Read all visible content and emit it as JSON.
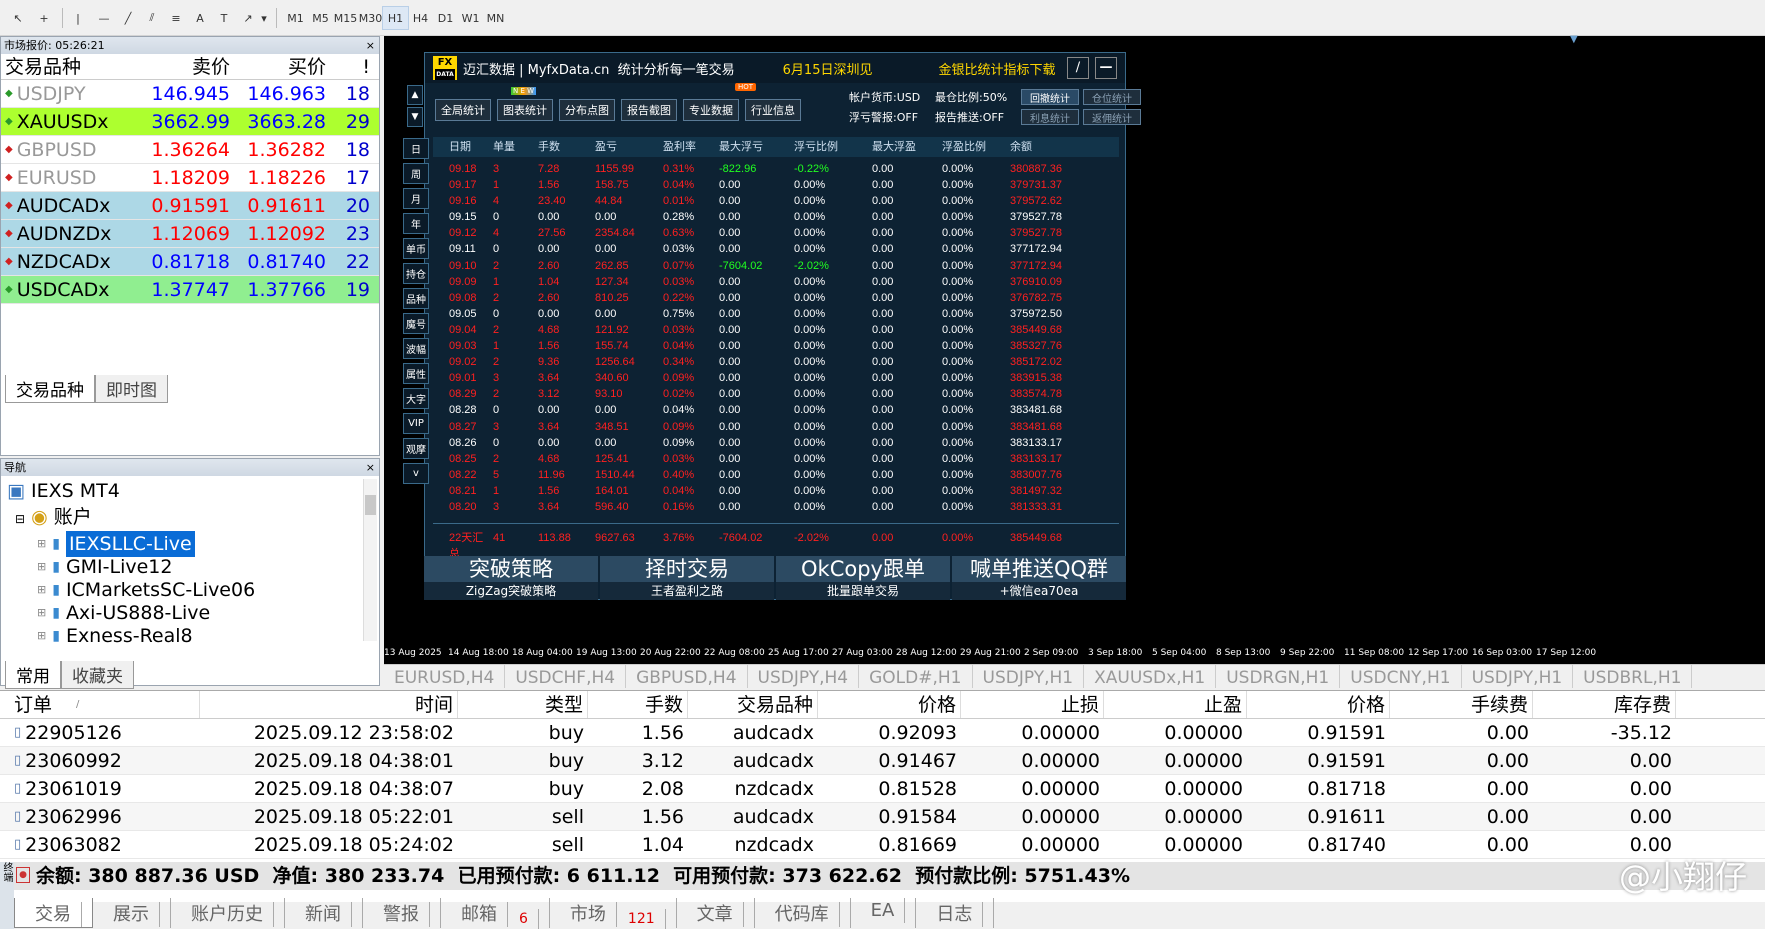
{
  "toolbar": {
    "timeframes": [
      "M1",
      "M5",
      "M15",
      "M30",
      "H1",
      "H4",
      "D1",
      "W1",
      "MN"
    ],
    "active": "H1"
  },
  "market_watch": {
    "title": "市场报价: 05:26:21",
    "close": "×",
    "headers": [
      "交易品种",
      "卖价",
      "买价",
      "!"
    ],
    "rows": [
      {
        "symbol": "USDJPY",
        "bid": "146.945",
        "ask": "146.963",
        "spread": "18",
        "bg": "#ffffff",
        "sym_color": "#999999",
        "price_color": "#0000ff",
        "icon_color": "#2a9a2a"
      },
      {
        "symbol": "XAUUSDx",
        "bid": "3662.99",
        "ask": "3663.28",
        "spread": "29",
        "bg": "#adff2f",
        "sym_color": "#000000",
        "price_color": "#0000ff",
        "icon_color": "#2a9a2a"
      },
      {
        "symbol": "GBPUSD",
        "bid": "1.36264",
        "ask": "1.36282",
        "spread": "18",
        "bg": "#ffffff",
        "sym_color": "#999999",
        "price_color": "#ff0000",
        "icon_color": "#d02020"
      },
      {
        "symbol": "EURUSD",
        "bid": "1.18209",
        "ask": "1.18226",
        "spread": "17",
        "bg": "#ffffff",
        "sym_color": "#999999",
        "price_color": "#ff0000",
        "icon_color": "#d02020"
      },
      {
        "symbol": "AUDCADx",
        "bid": "0.91591",
        "ask": "0.91611",
        "spread": "20",
        "bg": "#add8e6",
        "sym_color": "#000000",
        "price_color": "#ff0000",
        "icon_color": "#d02020"
      },
      {
        "symbol": "AUDNZDx",
        "bid": "1.12069",
        "ask": "1.12092",
        "spread": "23",
        "bg": "#add8e6",
        "sym_color": "#000000",
        "price_color": "#ff0000",
        "icon_color": "#d02020"
      },
      {
        "symbol": "NZDCADx",
        "bid": "0.81718",
        "ask": "0.81740",
        "spread": "22",
        "bg": "#add8e6",
        "sym_color": "#000000",
        "price_color": "#0000ff",
        "icon_color": "#d02020"
      },
      {
        "symbol": "USDCADx",
        "bid": "1.37747",
        "ask": "1.37766",
        "spread": "19",
        "bg": "#90ee90",
        "sym_color": "#000000",
        "price_color": "#0000ff",
        "icon_color": "#2a9a2a"
      }
    ],
    "tabs": [
      "交易品种",
      "即时图"
    ]
  },
  "navigator": {
    "title": "导航",
    "close": "×",
    "root": "IEXS MT4",
    "accounts_label": "账户",
    "accounts": [
      "IEXSLLC-Live",
      "GMI-Live12",
      "ICMarketsSC-Live06",
      "Axi-US888-Live",
      "Exness-Real8"
    ],
    "selected": "IEXSLLC-Live",
    "tabs": [
      "常用",
      "收藏夹"
    ]
  },
  "panel": {
    "logo_top": "FX",
    "logo_bottom": "DATA",
    "header_text": "迈汇数据 | MyfxData.cn  统计分析每一笔交易",
    "date_text": "6月15日深圳见",
    "right_text": "金银比统计指标下载",
    "buttons": [
      "全局统计",
      "图表统计",
      "分布点图",
      "报告截图",
      "专业数据",
      "行业信息"
    ],
    "badges": {
      "new": "N E W",
      "hot": "HOT"
    },
    "stats": [
      "帐户货币:USD",
      "最仓比例:50%",
      "浮亏警报:OFF",
      "报告推送:OFF"
    ],
    "stat_buttons": [
      "回撤统计",
      "仓位统计",
      "利息统计",
      "返佣统计"
    ],
    "side": [
      "日",
      "周",
      "月",
      "年",
      "单币",
      "持仓",
      "品种",
      "魔号",
      "波幅",
      "属性",
      "大字",
      "VIP",
      "观摩",
      "v"
    ],
    "columns": [
      "日期",
      "单量",
      "手数",
      "盈亏",
      "盈利率",
      "最大浮亏",
      "浮亏比例",
      "最大浮盈",
      "浮盈比例",
      "余额"
    ],
    "rows": [
      [
        "09.18",
        "3",
        "7.28",
        "1155.99",
        "0.31%",
        "-822.96",
        "-0.22%",
        "0.00",
        "0.00%",
        "380887.36",
        "r"
      ],
      [
        "09.17",
        "1",
        "1.56",
        "158.75",
        "0.04%",
        "0.00",
        "0.00%",
        "0.00",
        "0.00%",
        "379731.37",
        "r"
      ],
      [
        "09.16",
        "4",
        "23.40",
        "44.84",
        "0.01%",
        "0.00",
        "0.00%",
        "0.00",
        "0.00%",
        "379572.62",
        "r"
      ],
      [
        "09.15",
        "0",
        "0.00",
        "0.00",
        "0.28%",
        "0.00",
        "0.00%",
        "0.00",
        "0.00%",
        "379527.78",
        "w"
      ],
      [
        "09.12",
        "4",
        "27.56",
        "2354.84",
        "0.63%",
        "0.00",
        "0.00%",
        "0.00",
        "0.00%",
        "379527.78",
        "r"
      ],
      [
        "09.11",
        "0",
        "0.00",
        "0.00",
        "0.03%",
        "0.00",
        "0.00%",
        "0.00",
        "0.00%",
        "377172.94",
        "w"
      ],
      [
        "09.10",
        "2",
        "2.60",
        "262.85",
        "0.07%",
        "-7604.02",
        "-2.02%",
        "0.00",
        "0.00%",
        "377172.94",
        "r"
      ],
      [
        "09.09",
        "1",
        "1.04",
        "127.34",
        "0.03%",
        "0.00",
        "0.00%",
        "0.00",
        "0.00%",
        "376910.09",
        "r"
      ],
      [
        "09.08",
        "2",
        "2.60",
        "810.25",
        "0.22%",
        "0.00",
        "0.00%",
        "0.00",
        "0.00%",
        "376782.75",
        "r"
      ],
      [
        "09.05",
        "0",
        "0.00",
        "0.00",
        "0.75%",
        "0.00",
        "0.00%",
        "0.00",
        "0.00%",
        "375972.50",
        "w"
      ],
      [
        "09.04",
        "2",
        "4.68",
        "121.92",
        "0.03%",
        "0.00",
        "0.00%",
        "0.00",
        "0.00%",
        "385449.68",
        "r"
      ],
      [
        "09.03",
        "1",
        "1.56",
        "155.74",
        "0.04%",
        "0.00",
        "0.00%",
        "0.00",
        "0.00%",
        "385327.76",
        "r"
      ],
      [
        "09.02",
        "2",
        "9.36",
        "1256.64",
        "0.34%",
        "0.00",
        "0.00%",
        "0.00",
        "0.00%",
        "385172.02",
        "r"
      ],
      [
        "09.01",
        "3",
        "3.64",
        "340.60",
        "0.09%",
        "0.00",
        "0.00%",
        "0.00",
        "0.00%",
        "383915.38",
        "r"
      ],
      [
        "08.29",
        "2",
        "3.12",
        "93.10",
        "0.02%",
        "0.00",
        "0.00%",
        "0.00",
        "0.00%",
        "383574.78",
        "r"
      ],
      [
        "08.28",
        "0",
        "0.00",
        "0.00",
        "0.04%",
        "0.00",
        "0.00%",
        "0.00",
        "0.00%",
        "383481.68",
        "w"
      ],
      [
        "08.27",
        "3",
        "3.64",
        "348.51",
        "0.09%",
        "0.00",
        "0.00%",
        "0.00",
        "0.00%",
        "383481.68",
        "r"
      ],
      [
        "08.26",
        "0",
        "0.00",
        "0.00",
        "0.09%",
        "0.00",
        "0.00%",
        "0.00",
        "0.00%",
        "383133.17",
        "w"
      ],
      [
        "08.25",
        "2",
        "4.68",
        "125.41",
        "0.03%",
        "0.00",
        "0.00%",
        "0.00",
        "0.00%",
        "383133.17",
        "r"
      ],
      [
        "08.22",
        "5",
        "11.96",
        "1510.44",
        "0.40%",
        "0.00",
        "0.00%",
        "0.00",
        "0.00%",
        "383007.76",
        "r"
      ],
      [
        "08.21",
        "1",
        "1.56",
        "164.01",
        "0.04%",
        "0.00",
        "0.00%",
        "0.00",
        "0.00%",
        "381497.32",
        "r"
      ],
      [
        "08.20",
        "3",
        "3.64",
        "596.40",
        "0.16%",
        "0.00",
        "0.00%",
        "0.00",
        "0.00%",
        "381333.31",
        "r"
      ]
    ],
    "summary": [
      "22天汇总",
      "41",
      "113.88",
      "9627.63",
      "3.76%",
      "-7604.02",
      "-2.02%",
      "0.00",
      "0.00%",
      "385449.68"
    ],
    "promos": [
      {
        "big": "突破策略",
        "small": "ZigZag突破策略"
      },
      {
        "big": "择时交易",
        "small": "王者盈利之路"
      },
      {
        "big": "OkCopy跟单",
        "small": "批量跟单交易"
      },
      {
        "big": "喊单推送QQ群",
        "small": "+微信ea70ea"
      }
    ]
  },
  "time_axis": [
    "13 Aug 2025",
    "14 Aug 18:00",
    "18 Aug 04:00",
    "19 Aug 13:00",
    "20 Aug 22:00",
    "22 Aug 08:00",
    "25 Aug 17:00",
    "27 Aug 03:00",
    "28 Aug 12:00",
    "29 Aug 21:00",
    "2 Sep 09:00",
    "3 Sep 18:00",
    "5 Sep 04:00",
    "8 Sep 13:00",
    "9 Sep 22:00",
    "11 Sep 08:00",
    "12 Sep 17:00",
    "16 Sep 03:00",
    "17 Sep 12:00"
  ],
  "chart_tabs": [
    "EURUSD,H4",
    "USDCHF,H4",
    "GBPUSD,H4",
    "USDJPY,H4",
    "GOLD#,H1",
    "USDJPY,H1",
    "XAUUSDx,H1",
    "USDRGN,H1",
    "USDCNY,H1",
    "USDJPY,H1",
    "USDBRL,H1"
  ],
  "terminal": {
    "headers": [
      "订单",
      "时间",
      "类型",
      "手数",
      "交易品种",
      "价格",
      "止损",
      "止盈",
      "价格",
      "手续费",
      "库存费"
    ],
    "sort_mark": "/",
    "rows": [
      [
        "22905126",
        "2025.09.12 23:58:02",
        "buy",
        "1.56",
        "audcadx",
        "0.92093",
        "0.00000",
        "0.00000",
        "0.91591",
        "0.00",
        "-35.12"
      ],
      [
        "23060992",
        "2025.09.18 04:38:01",
        "buy",
        "3.12",
        "audcadx",
        "0.91467",
        "0.00000",
        "0.00000",
        "0.91591",
        "0.00",
        "0.00"
      ],
      [
        "23061019",
        "2025.09.18 04:38:07",
        "buy",
        "2.08",
        "nzdcadx",
        "0.81528",
        "0.00000",
        "0.00000",
        "0.81718",
        "0.00",
        "0.00"
      ],
      [
        "23062996",
        "2025.09.18 05:22:01",
        "sell",
        "1.56",
        "audcadx",
        "0.91584",
        "0.00000",
        "0.00000",
        "0.91611",
        "0.00",
        "0.00"
      ],
      [
        "23063082",
        "2025.09.18 05:24:02",
        "sell",
        "1.04",
        "nzdcadx",
        "0.81669",
        "0.00000",
        "0.00000",
        "0.81740",
        "0.00",
        "0.00"
      ]
    ],
    "summary": "余额: 380 887.36 USD  净值: 380 233.74  已用预付款: 6 611.12  可用预付款: 373 622.62  预付款比例: 5751.43%",
    "tabs": [
      {
        "label": "交易",
        "count": ""
      },
      {
        "label": "展示",
        "count": ""
      },
      {
        "label": "账户历史",
        "count": ""
      },
      {
        "label": "新闻",
        "count": ""
      },
      {
        "label": "警报",
        "count": ""
      },
      {
        "label": "邮箱",
        "count": "6"
      },
      {
        "label": "市场",
        "count": "121"
      },
      {
        "label": "文章",
        "count": ""
      },
      {
        "label": "代码库",
        "count": ""
      },
      {
        "label": "EA",
        "count": ""
      },
      {
        "label": "日志",
        "count": ""
      }
    ],
    "side_label": "终端"
  },
  "watermark": "@小翔仔",
  "colors": {
    "red": "#ff2020",
    "green": "#20ff20",
    "white": "#ffffff",
    "gold": "#ffd700"
  }
}
